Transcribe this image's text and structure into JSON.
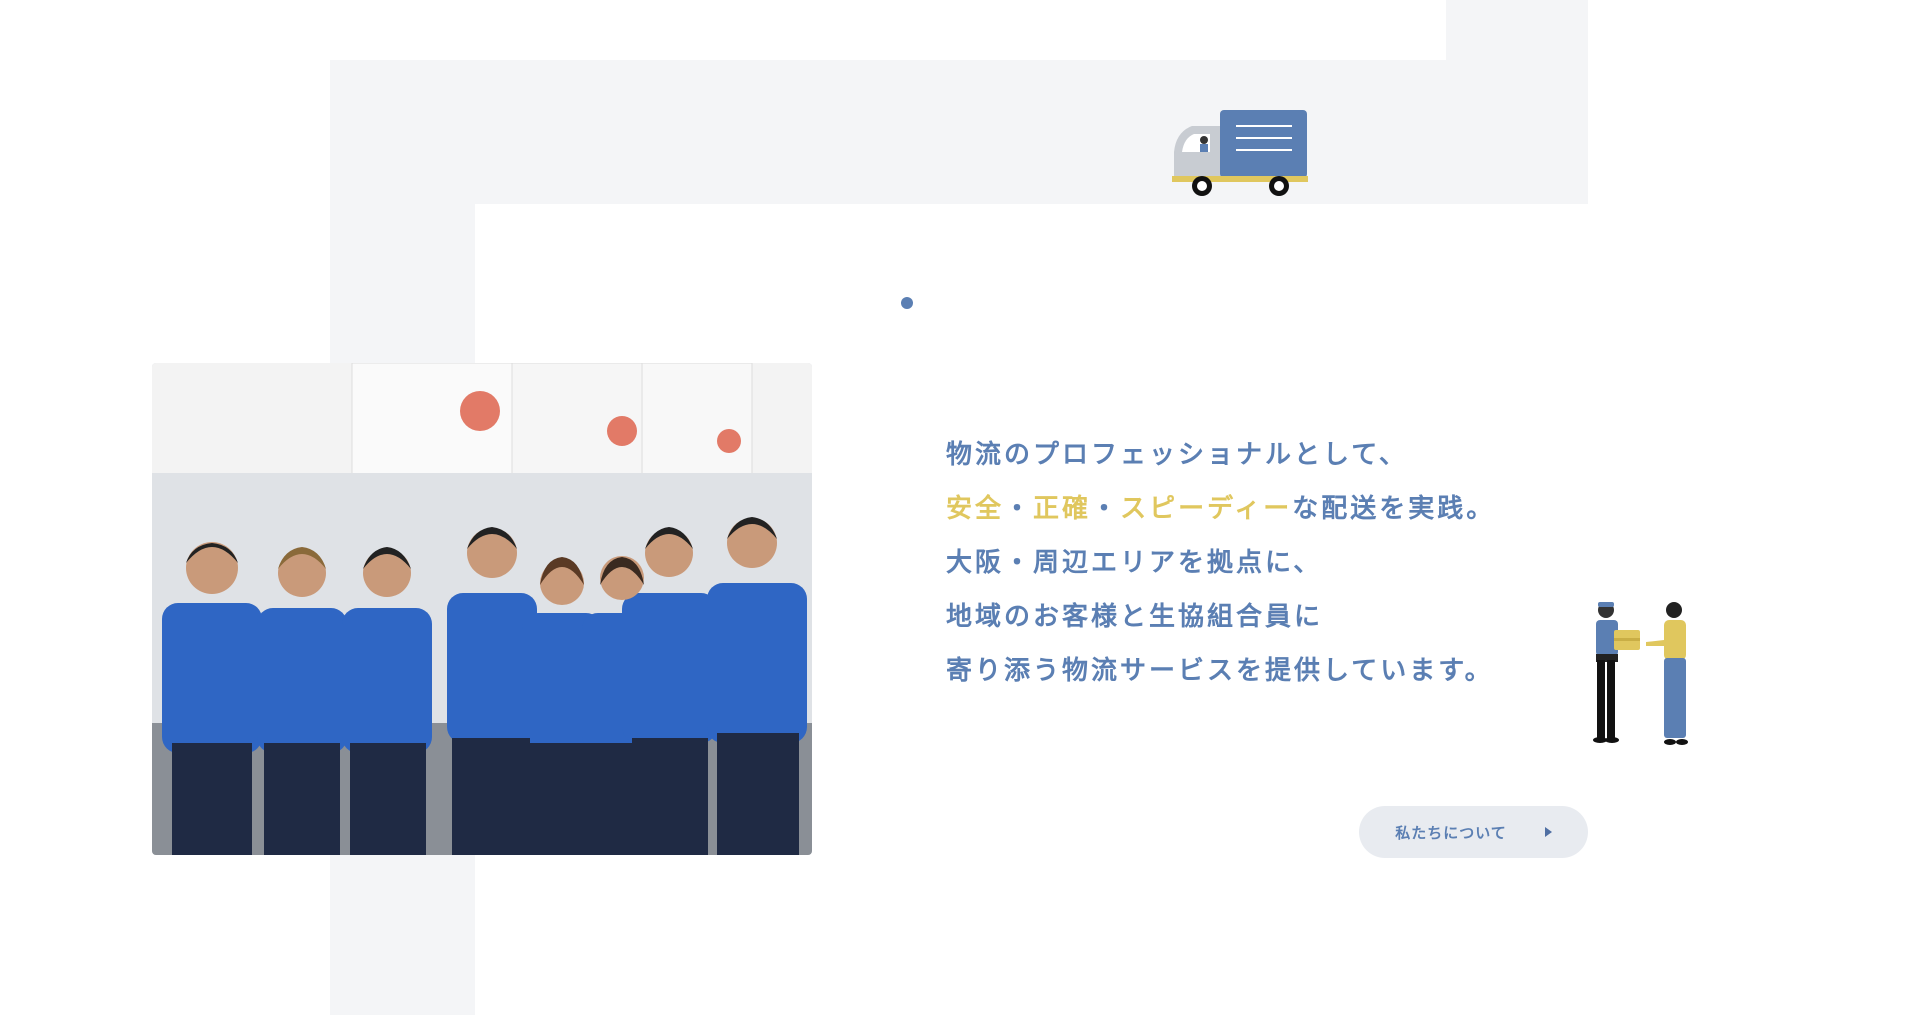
{
  "lead": {
    "line1": "物流のプロフェッショナルとして、",
    "line2_hl1": "安全",
    "line2_sep1": "・",
    "line2_hl2": "正確",
    "line2_sep2": "・",
    "line2_hl3": "スピーディー",
    "line2_rest": "な配送を実践。",
    "line3": "大阪・周辺エリアを拠点に、",
    "line4": "地域のお客様と生協組合員に",
    "line5": "寄り添う物流サービスを提供しています。"
  },
  "about_button": {
    "label": "私たちについて"
  },
  "colors": {
    "accent_blue": "#5b7fb3",
    "highlight_yellow": "#e0c75e",
    "band_gray": "#f4f5f7"
  },
  "icons": {
    "truck": "truck-illustration",
    "arrow": "play-arrow-icon",
    "people": "delivery-handover-illustration"
  }
}
